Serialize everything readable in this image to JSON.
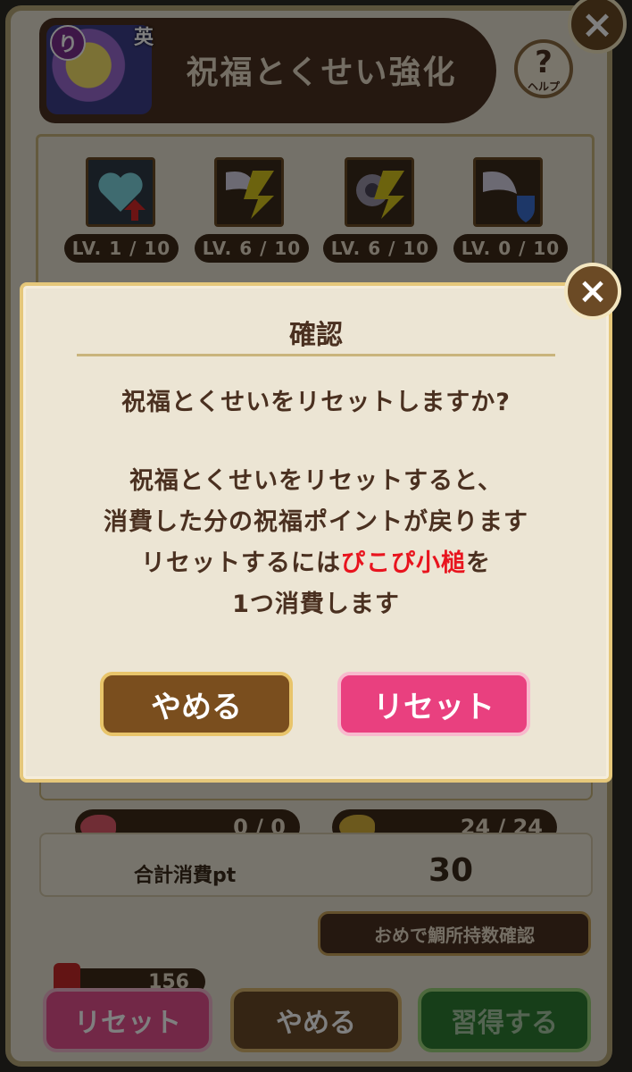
{
  "header": {
    "avatar_badge": "り",
    "avatar_tag": "英",
    "title": "祝福とくせい強化",
    "help_symbol": "?",
    "help_label": "ヘルプ"
  },
  "skills": [
    {
      "level": "LV. 1 / 10",
      "icon": "heart-up-icon"
    },
    {
      "level": "LV. 6 / 10",
      "icon": "wing-attack-icon"
    },
    {
      "level": "LV. 6 / 10",
      "icon": "vortex-attack-icon"
    },
    {
      "level": "LV. 0 / 10",
      "icon": "wing-shield-icon"
    }
  ],
  "points": {
    "red_fish": "0 / 0",
    "gold_fish": "24 / 24",
    "total_label": "合計消費pt",
    "total_value": "30",
    "confirm_stock": "おめで鯛所持数確認"
  },
  "bottom": {
    "hammer_count": "156",
    "reset_label": "リセット",
    "cancel_label": "やめる",
    "learn_label": "習得する"
  },
  "dialog": {
    "title": "確認",
    "question": "祝福とくせいをリセットしますか?",
    "line1": "祝福とくせいをリセットすると、",
    "line2": "消費した分の祝福ポイントが戻ります",
    "line3_prefix": "リセットするには",
    "line3_highlight": "ぴこぴ小槌",
    "line3_suffix": "を",
    "line4": "1つ消費します",
    "cancel_button": "やめる",
    "reset_button": "リセット"
  },
  "colors": {
    "highlight": "#e8141e",
    "reset_pink": "#e9407f",
    "cancel_brown": "#7a4e1e"
  }
}
